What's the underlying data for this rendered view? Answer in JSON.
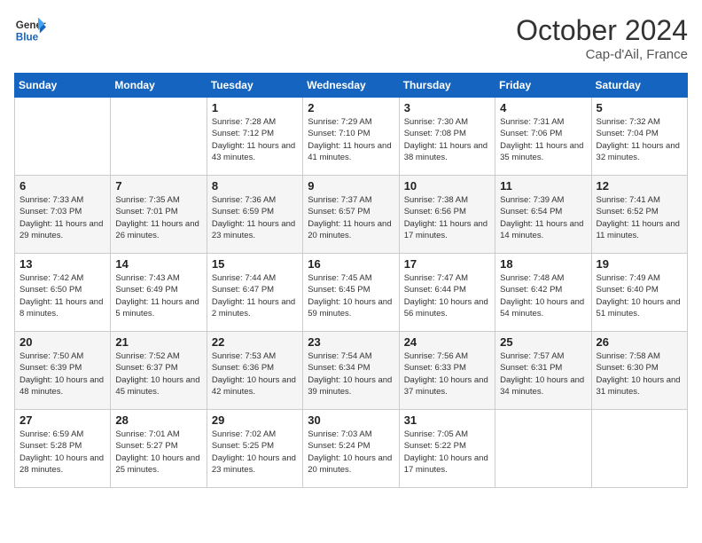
{
  "header": {
    "logo_general": "General",
    "logo_blue": "Blue",
    "month": "October 2024",
    "location": "Cap-d'Ail, France"
  },
  "weekdays": [
    "Sunday",
    "Monday",
    "Tuesday",
    "Wednesday",
    "Thursday",
    "Friday",
    "Saturday"
  ],
  "weeks": [
    [
      {
        "day": null
      },
      {
        "day": null
      },
      {
        "day": "1",
        "sunrise": "Sunrise: 7:28 AM",
        "sunset": "Sunset: 7:12 PM",
        "daylight": "Daylight: 11 hours and 43 minutes."
      },
      {
        "day": "2",
        "sunrise": "Sunrise: 7:29 AM",
        "sunset": "Sunset: 7:10 PM",
        "daylight": "Daylight: 11 hours and 41 minutes."
      },
      {
        "day": "3",
        "sunrise": "Sunrise: 7:30 AM",
        "sunset": "Sunset: 7:08 PM",
        "daylight": "Daylight: 11 hours and 38 minutes."
      },
      {
        "day": "4",
        "sunrise": "Sunrise: 7:31 AM",
        "sunset": "Sunset: 7:06 PM",
        "daylight": "Daylight: 11 hours and 35 minutes."
      },
      {
        "day": "5",
        "sunrise": "Sunrise: 7:32 AM",
        "sunset": "Sunset: 7:04 PM",
        "daylight": "Daylight: 11 hours and 32 minutes."
      }
    ],
    [
      {
        "day": "6",
        "sunrise": "Sunrise: 7:33 AM",
        "sunset": "Sunset: 7:03 PM",
        "daylight": "Daylight: 11 hours and 29 minutes."
      },
      {
        "day": "7",
        "sunrise": "Sunrise: 7:35 AM",
        "sunset": "Sunset: 7:01 PM",
        "daylight": "Daylight: 11 hours and 26 minutes."
      },
      {
        "day": "8",
        "sunrise": "Sunrise: 7:36 AM",
        "sunset": "Sunset: 6:59 PM",
        "daylight": "Daylight: 11 hours and 23 minutes."
      },
      {
        "day": "9",
        "sunrise": "Sunrise: 7:37 AM",
        "sunset": "Sunset: 6:57 PM",
        "daylight": "Daylight: 11 hours and 20 minutes."
      },
      {
        "day": "10",
        "sunrise": "Sunrise: 7:38 AM",
        "sunset": "Sunset: 6:56 PM",
        "daylight": "Daylight: 11 hours and 17 minutes."
      },
      {
        "day": "11",
        "sunrise": "Sunrise: 7:39 AM",
        "sunset": "Sunset: 6:54 PM",
        "daylight": "Daylight: 11 hours and 14 minutes."
      },
      {
        "day": "12",
        "sunrise": "Sunrise: 7:41 AM",
        "sunset": "Sunset: 6:52 PM",
        "daylight": "Daylight: 11 hours and 11 minutes."
      }
    ],
    [
      {
        "day": "13",
        "sunrise": "Sunrise: 7:42 AM",
        "sunset": "Sunset: 6:50 PM",
        "daylight": "Daylight: 11 hours and 8 minutes."
      },
      {
        "day": "14",
        "sunrise": "Sunrise: 7:43 AM",
        "sunset": "Sunset: 6:49 PM",
        "daylight": "Daylight: 11 hours and 5 minutes."
      },
      {
        "day": "15",
        "sunrise": "Sunrise: 7:44 AM",
        "sunset": "Sunset: 6:47 PM",
        "daylight": "Daylight: 11 hours and 2 minutes."
      },
      {
        "day": "16",
        "sunrise": "Sunrise: 7:45 AM",
        "sunset": "Sunset: 6:45 PM",
        "daylight": "Daylight: 10 hours and 59 minutes."
      },
      {
        "day": "17",
        "sunrise": "Sunrise: 7:47 AM",
        "sunset": "Sunset: 6:44 PM",
        "daylight": "Daylight: 10 hours and 56 minutes."
      },
      {
        "day": "18",
        "sunrise": "Sunrise: 7:48 AM",
        "sunset": "Sunset: 6:42 PM",
        "daylight": "Daylight: 10 hours and 54 minutes."
      },
      {
        "day": "19",
        "sunrise": "Sunrise: 7:49 AM",
        "sunset": "Sunset: 6:40 PM",
        "daylight": "Daylight: 10 hours and 51 minutes."
      }
    ],
    [
      {
        "day": "20",
        "sunrise": "Sunrise: 7:50 AM",
        "sunset": "Sunset: 6:39 PM",
        "daylight": "Daylight: 10 hours and 48 minutes."
      },
      {
        "day": "21",
        "sunrise": "Sunrise: 7:52 AM",
        "sunset": "Sunset: 6:37 PM",
        "daylight": "Daylight: 10 hours and 45 minutes."
      },
      {
        "day": "22",
        "sunrise": "Sunrise: 7:53 AM",
        "sunset": "Sunset: 6:36 PM",
        "daylight": "Daylight: 10 hours and 42 minutes."
      },
      {
        "day": "23",
        "sunrise": "Sunrise: 7:54 AM",
        "sunset": "Sunset: 6:34 PM",
        "daylight": "Daylight: 10 hours and 39 minutes."
      },
      {
        "day": "24",
        "sunrise": "Sunrise: 7:56 AM",
        "sunset": "Sunset: 6:33 PM",
        "daylight": "Daylight: 10 hours and 37 minutes."
      },
      {
        "day": "25",
        "sunrise": "Sunrise: 7:57 AM",
        "sunset": "Sunset: 6:31 PM",
        "daylight": "Daylight: 10 hours and 34 minutes."
      },
      {
        "day": "26",
        "sunrise": "Sunrise: 7:58 AM",
        "sunset": "Sunset: 6:30 PM",
        "daylight": "Daylight: 10 hours and 31 minutes."
      }
    ],
    [
      {
        "day": "27",
        "sunrise": "Sunrise: 6:59 AM",
        "sunset": "Sunset: 5:28 PM",
        "daylight": "Daylight: 10 hours and 28 minutes."
      },
      {
        "day": "28",
        "sunrise": "Sunrise: 7:01 AM",
        "sunset": "Sunset: 5:27 PM",
        "daylight": "Daylight: 10 hours and 25 minutes."
      },
      {
        "day": "29",
        "sunrise": "Sunrise: 7:02 AM",
        "sunset": "Sunset: 5:25 PM",
        "daylight": "Daylight: 10 hours and 23 minutes."
      },
      {
        "day": "30",
        "sunrise": "Sunrise: 7:03 AM",
        "sunset": "Sunset: 5:24 PM",
        "daylight": "Daylight: 10 hours and 20 minutes."
      },
      {
        "day": "31",
        "sunrise": "Sunrise: 7:05 AM",
        "sunset": "Sunset: 5:22 PM",
        "daylight": "Daylight: 10 hours and 17 minutes."
      },
      {
        "day": null
      },
      {
        "day": null
      }
    ]
  ]
}
